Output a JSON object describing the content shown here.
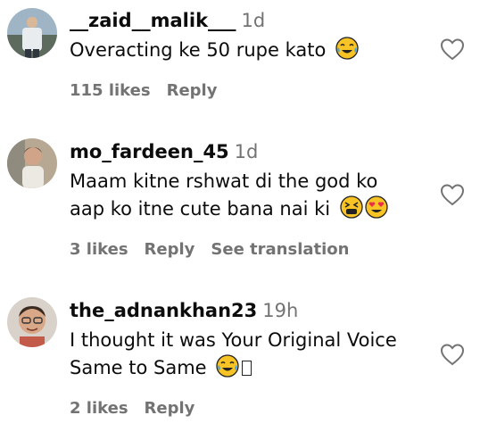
{
  "comments": [
    {
      "username": "__zaid__malik___",
      "time": "1d",
      "lines": [
        "Overacting ke 50 rupe kato"
      ],
      "likes": "115 likes",
      "reply": "Reply",
      "translation": ""
    },
    {
      "username": "mo_fardeen_45",
      "time": "1d",
      "lines": [
        "Maam kitne rshwat di the god ko",
        "aap ko itne cute bana nai ki"
      ],
      "likes": "3 likes",
      "reply": "Reply",
      "translation": "See translation"
    },
    {
      "username": "the_adnankhan23",
      "time": "19h",
      "lines": [
        "I thought it was Your Original Voice",
        "Same to Same"
      ],
      "likes": "2 likes",
      "reply": "Reply",
      "translation": ""
    }
  ],
  "icons": {
    "like": "heart-outline-icon",
    "emoji_laugh": "tears-of-joy-emoji",
    "emoji_tired": "tired-face-emoji",
    "emoji_love": "heart-eyes-emoji"
  },
  "colors": {
    "text": "#0c0c0c",
    "secondary": "#737373",
    "emoji_yellow": "#f7c325"
  }
}
